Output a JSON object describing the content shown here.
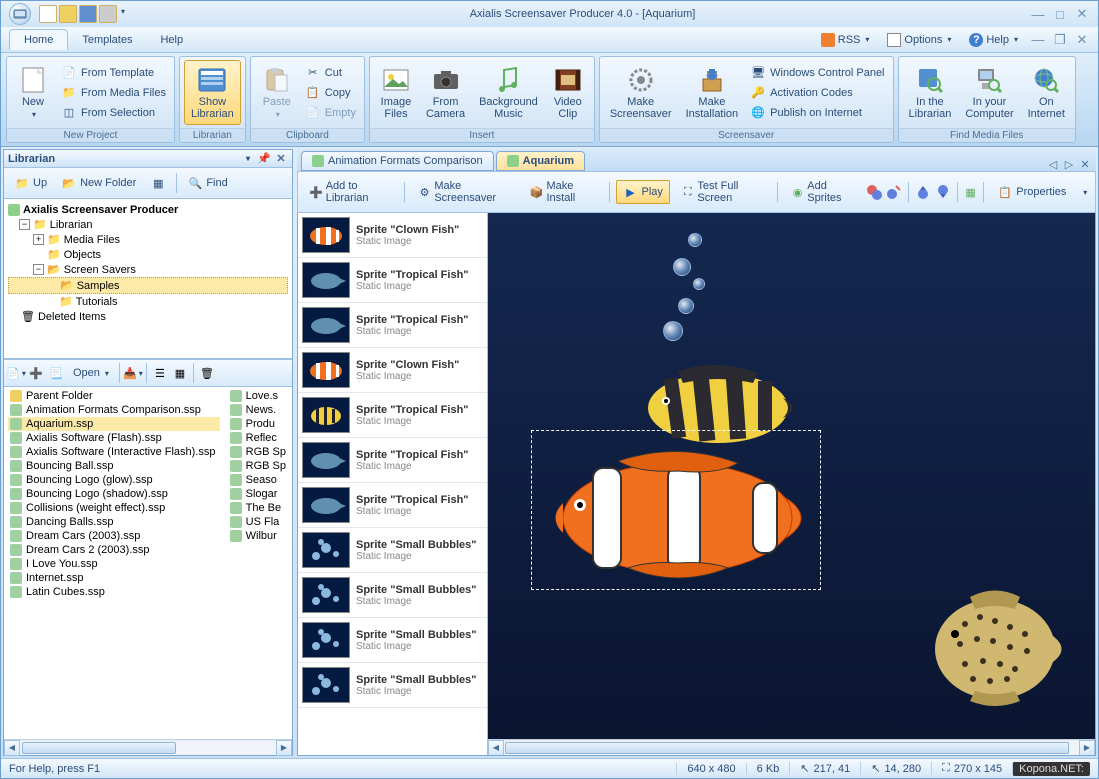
{
  "title": "Axialis Screensaver Producer 4.0 - [Aquarium]",
  "menu": {
    "home": "Home",
    "templates": "Templates",
    "help": "Help"
  },
  "topright": {
    "rss": "RSS",
    "options": "Options",
    "help": "Help"
  },
  "ribbon": {
    "new_project": {
      "label": "New Project",
      "new": "New",
      "from_template": "From Template",
      "from_media": "From Media Files",
      "from_selection": "From Selection"
    },
    "librarian": {
      "label": "Librarian",
      "show": "Show\nLibrarian"
    },
    "clipboard": {
      "label": "Clipboard",
      "paste": "Paste",
      "cut": "Cut",
      "copy": "Copy",
      "empty": "Empty"
    },
    "insert": {
      "label": "Insert",
      "image": "Image\nFiles",
      "camera": "From\nCamera",
      "music": "Background\nMusic",
      "video": "Video\nClip"
    },
    "screensaver": {
      "label": "Screensaver",
      "make": "Make\nScreensaver",
      "install": "Make\nInstallation",
      "cpanel": "Windows Control Panel",
      "codes": "Activation Codes",
      "publish": "Publish on Internet"
    },
    "find": {
      "label": "Find Media Files",
      "librarian": "In the\nLibrarian",
      "computer": "In your\nComputer",
      "internet": "On\nInternet"
    }
  },
  "librarian": {
    "title": "Librarian",
    "up": "Up",
    "new_folder": "New Folder",
    "find": "Find",
    "tree": {
      "root": "Axialis Screensaver Producer",
      "librarian": "Librarian",
      "media": "Media Files",
      "objects": "Objects",
      "screensavers": "Screen Savers",
      "samples": "Samples",
      "tutorials": "Tutorials",
      "deleted": "Deleted Items"
    },
    "open": "Open",
    "files_col1": [
      {
        "name": "Parent Folder",
        "folder": true
      },
      {
        "name": "Animation Formats Comparison.ssp"
      },
      {
        "name": "Aquarium.ssp",
        "sel": true
      },
      {
        "name": "Axialis Software (Flash).ssp"
      },
      {
        "name": "Axialis Software (Interactive Flash).ssp"
      },
      {
        "name": "Bouncing Ball.ssp"
      },
      {
        "name": "Bouncing Logo (glow).ssp"
      },
      {
        "name": "Bouncing Logo (shadow).ssp"
      },
      {
        "name": "Collisions (weight effect).ssp"
      },
      {
        "name": "Dancing Balls.ssp"
      },
      {
        "name": "Dream Cars (2003).ssp"
      },
      {
        "name": "Dream Cars 2 (2003).ssp"
      },
      {
        "name": "I Love You.ssp"
      },
      {
        "name": "Internet.ssp"
      },
      {
        "name": "Latin Cubes.ssp"
      }
    ],
    "files_col2": [
      {
        "name": "Love.s"
      },
      {
        "name": "News."
      },
      {
        "name": "Produ"
      },
      {
        "name": "Reflec"
      },
      {
        "name": "RGB Sp"
      },
      {
        "name": "RGB Sp"
      },
      {
        "name": "Seaso"
      },
      {
        "name": "Slogar"
      },
      {
        "name": "The Be"
      },
      {
        "name": "US Fla"
      },
      {
        "name": "Wilbur"
      }
    ]
  },
  "tabs": [
    {
      "label": "Animation Formats Comparison"
    },
    {
      "label": "Aquarium",
      "active": true
    }
  ],
  "doc_toolbar": {
    "add": "Add to Librarian",
    "make": "Make Screensaver",
    "install": "Make Install",
    "play": "Play",
    "test": "Test Full Screen",
    "sprites": "Add Sprites",
    "props": "Properties"
  },
  "sprites": [
    {
      "name": "Sprite \"Clown Fish\"",
      "type": "Static Image",
      "thumb": "clown"
    },
    {
      "name": "Sprite \"Tropical Fish\"",
      "type": "Static Image",
      "thumb": "tropical1"
    },
    {
      "name": "Sprite \"Tropical Fish\"",
      "type": "Static Image",
      "thumb": "tropical2"
    },
    {
      "name": "Sprite \"Clown Fish\"",
      "type": "Static Image",
      "thumb": "clown"
    },
    {
      "name": "Sprite \"Tropical Fish\"",
      "type": "Static Image",
      "thumb": "tropical3"
    },
    {
      "name": "Sprite \"Tropical Fish\"",
      "type": "Static Image",
      "thumb": "tropical4"
    },
    {
      "name": "Sprite \"Tropical Fish\"",
      "type": "Static Image",
      "thumb": "tropical5"
    },
    {
      "name": "Sprite \"Small Bubbles\"",
      "type": "Static Image",
      "thumb": "bubbles"
    },
    {
      "name": "Sprite \"Small Bubbles\"",
      "type": "Static Image",
      "thumb": "bubbles"
    },
    {
      "name": "Sprite \"Small Bubbles\"",
      "type": "Static Image",
      "thumb": "bubbles"
    },
    {
      "name": "Sprite \"Small Bubbles\"",
      "type": "Static Image",
      "thumb": "bubbles"
    }
  ],
  "status": {
    "help": "For Help, press F1",
    "dims": "640 x 480",
    "size": "6 Kb",
    "pos1": "217, 41",
    "pos2": "14, 280",
    "sel": "270 x 145",
    "watermark": "Kopona.NET:"
  }
}
